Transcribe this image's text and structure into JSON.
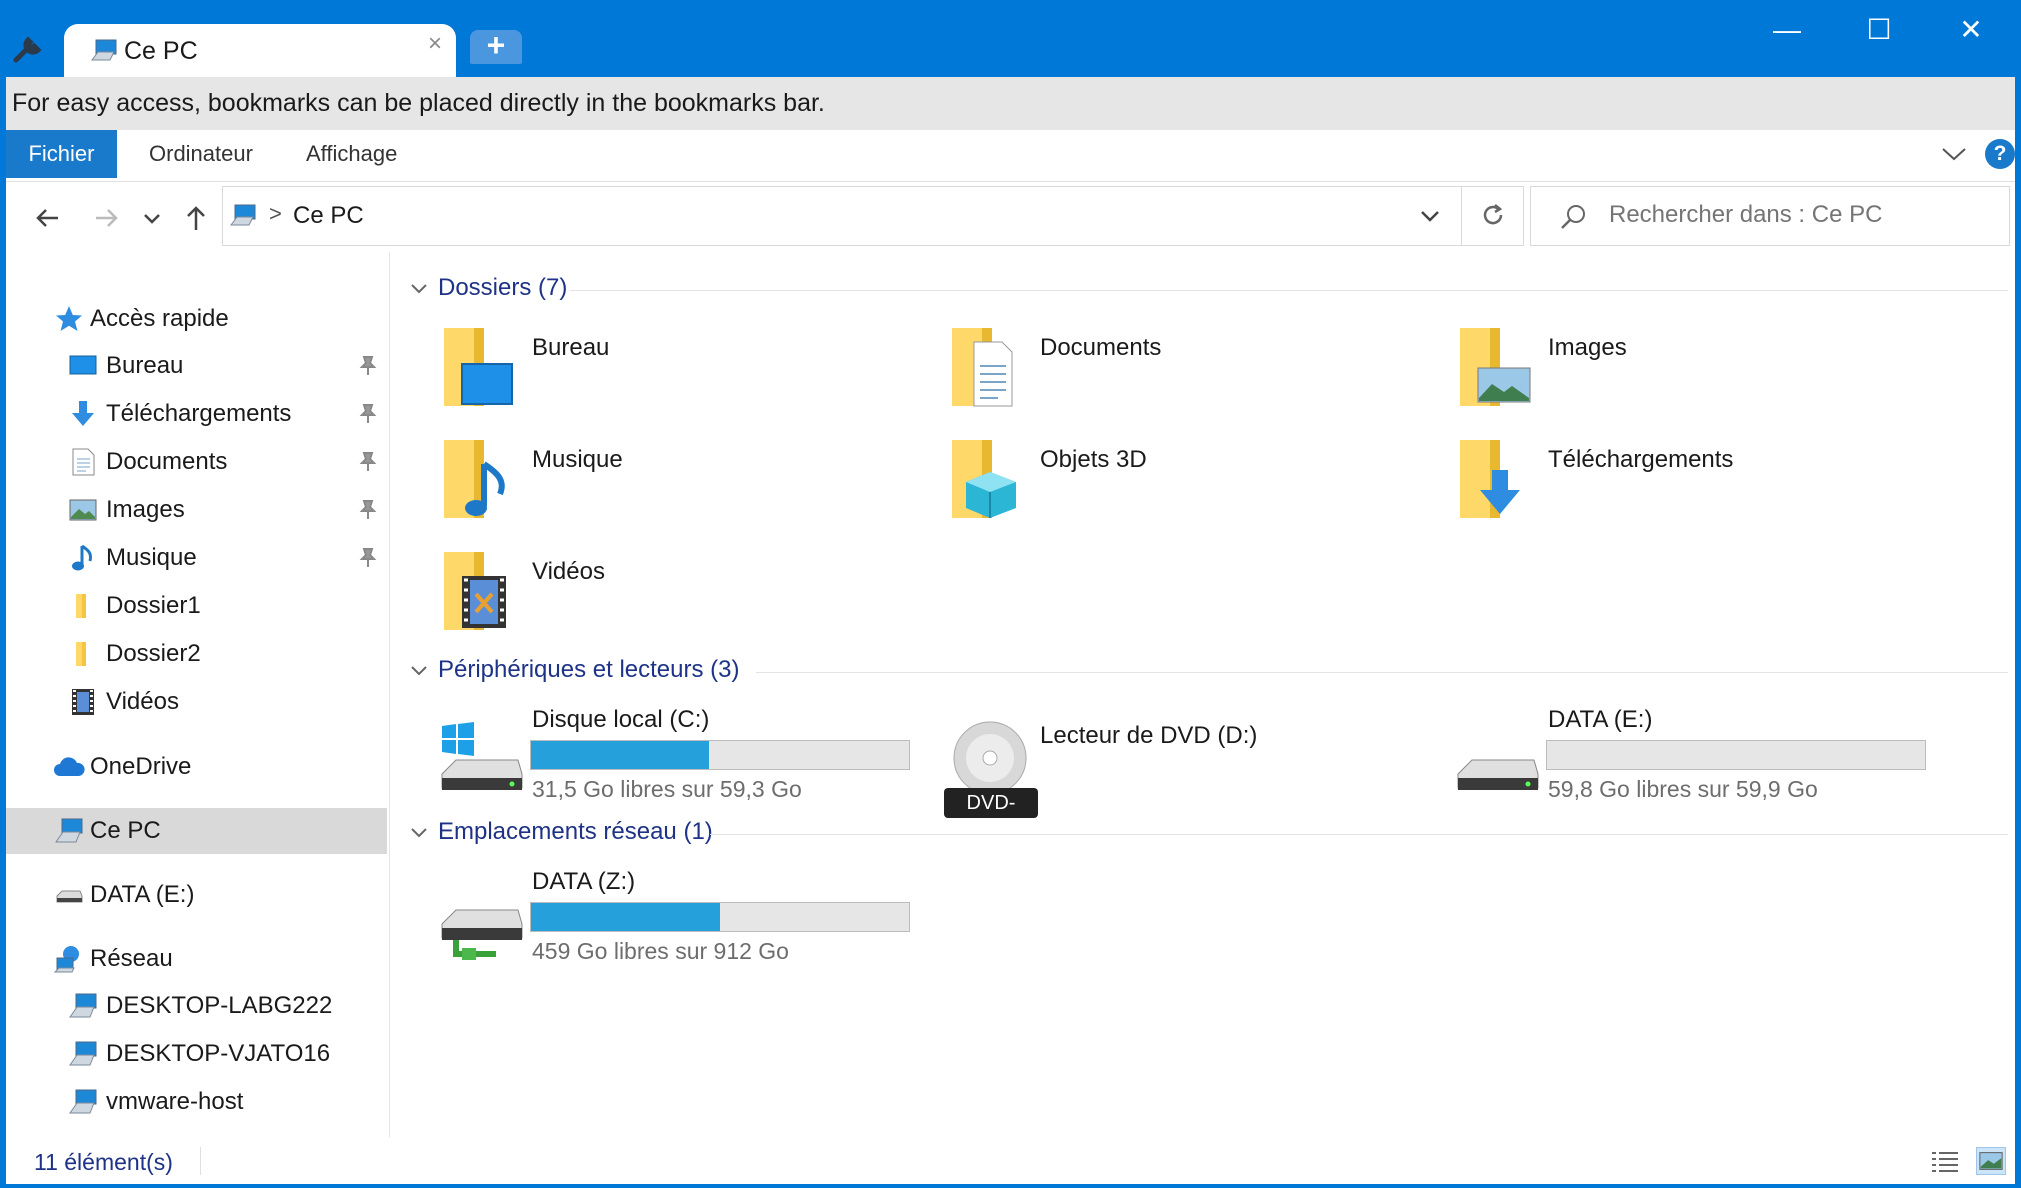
{
  "window": {
    "tab_title": "Ce PC",
    "tab_close": "×",
    "new_tab": "+",
    "minimize": "—",
    "maximize": "☐",
    "close": "✕",
    "accent_color": "#0078d7"
  },
  "bookmark_hint": "For easy access, bookmarks can be placed directly in the bookmarks bar.",
  "ribbon": {
    "tabs": [
      "Fichier",
      "Ordinateur",
      "Affichage"
    ],
    "active_tab": "Fichier",
    "help": "?"
  },
  "address": {
    "separator": ">",
    "path": "Ce PC",
    "search_placeholder": "Rechercher dans : Ce PC"
  },
  "sidebar": {
    "quick_access": "Accès rapide",
    "items": [
      {
        "label": "Bureau",
        "icon": "desktop-icon",
        "pinned": true
      },
      {
        "label": "Téléchargements",
        "icon": "download-icon",
        "pinned": true
      },
      {
        "label": "Documents",
        "icon": "document-icon",
        "pinned": true
      },
      {
        "label": "Images",
        "icon": "picture-icon",
        "pinned": true
      },
      {
        "label": "Musique",
        "icon": "music-icon",
        "pinned": true
      },
      {
        "label": "Dossier1",
        "icon": "folder-icon",
        "pinned": false
      },
      {
        "label": "Dossier2",
        "icon": "folder-icon",
        "pinned": false
      },
      {
        "label": "Vidéos",
        "icon": "video-icon",
        "pinned": false
      }
    ],
    "onedrive": "OneDrive",
    "this_pc": "Ce PC",
    "data_drive": "DATA (E:)",
    "network": "Réseau",
    "network_items": [
      "DESKTOP-LABG222",
      "DESKTOP-VJATO16",
      "vmware-host"
    ]
  },
  "groups": {
    "folders": {
      "title": "Dossiers (7)",
      "items": [
        "Bureau",
        "Documents",
        "Images",
        "Musique",
        "Objets 3D",
        "Téléchargements",
        "Vidéos"
      ]
    },
    "devices": {
      "title": "Périphériques et lecteurs (3)",
      "drives": [
        {
          "label": "Disque local (C:)",
          "free": "31,5 Go libres sur 59,3 Go",
          "used_fraction": 0.47
        },
        {
          "label": "Lecteur de DVD (D:)",
          "badge": "DVD-ROM"
        },
        {
          "label": "DATA (E:)",
          "free": "59,8 Go libres sur 59,9 Go",
          "used_fraction": 0.0
        }
      ]
    },
    "network": {
      "title": "Emplacements réseau (1)",
      "drives": [
        {
          "label": "DATA (Z:)",
          "free": "459 Go libres sur 912 Go",
          "used_fraction": 0.5
        }
      ]
    }
  },
  "status": {
    "count": "11 élément(s)"
  }
}
